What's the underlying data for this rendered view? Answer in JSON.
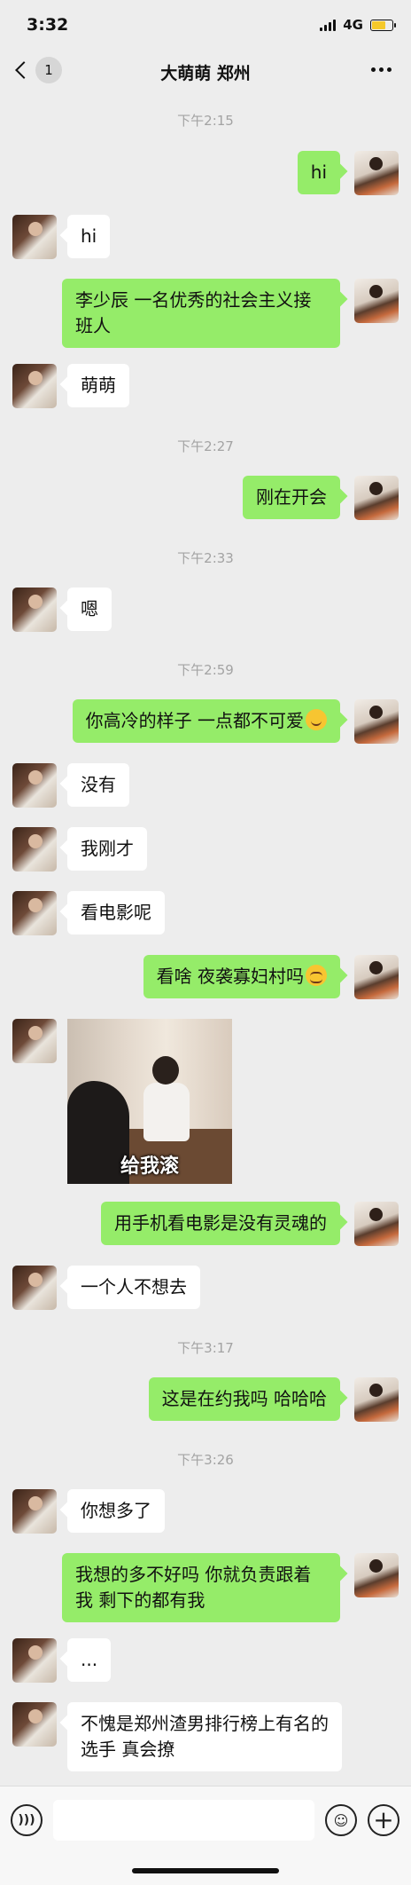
{
  "status": {
    "time": "3:32",
    "network": "4G"
  },
  "nav": {
    "unread_count": "1",
    "title": "大萌萌 郑州"
  },
  "timestamps": [
    "下午2:15",
    "下午2:27",
    "下午2:33",
    "下午2:59",
    "下午3:17",
    "下午3:26"
  ],
  "messages": [
    "hi",
    "hi",
    "李少辰 一名优秀的社会主义接班人",
    "萌萌",
    "刚在开会",
    "嗯",
    "你高冷的样子 一点都不可爱",
    "没有",
    "我刚才",
    "看电影呢",
    "看啥 夜袭寡妇村吗",
    "用手机看电影是没有灵魂的",
    "一个人不想去",
    "这是在约我吗 哈哈哈",
    "你想多了",
    "我想的多不好吗 你就负责跟着我 剩下的都有我",
    "...",
    "不愧是郑州渣男排行榜上有名的选手 真会撩"
  ],
  "sticker": {
    "caption": "给我滚"
  },
  "input": {
    "placeholder": ""
  },
  "icons": {
    "signal": "signal-icon",
    "battery": "battery-charging-icon",
    "back": "chevron-left-icon",
    "more": "more-dots-icon",
    "voice": "voice-icon",
    "emoji": "emoji-icon",
    "plus": "plus-icon"
  }
}
